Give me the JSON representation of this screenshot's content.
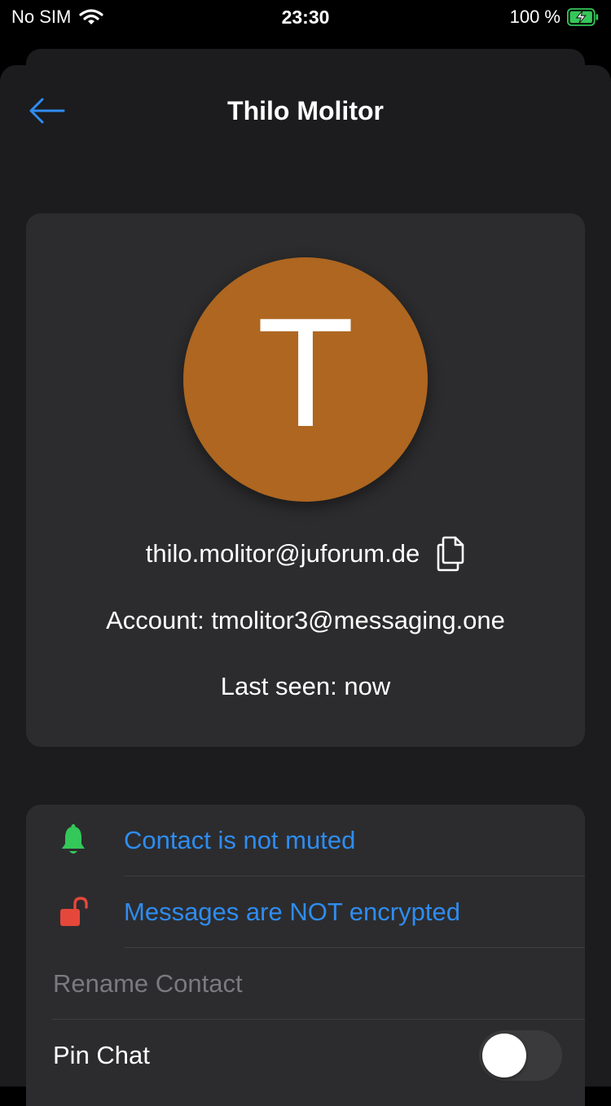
{
  "status_bar": {
    "carrier": "No SIM",
    "time": "23:30",
    "battery_percent": "100 %",
    "battery_level": 1.0
  },
  "nav": {
    "title": "Thilo Molitor"
  },
  "profile": {
    "avatar_letter": "T",
    "avatar_color": "#ae6620",
    "email": "thilo.molitor@juforum.de",
    "account": "Account: tmolitor3@messaging.one",
    "last_seen": "Last seen: now"
  },
  "settings": {
    "mute_label": "Contact is not muted",
    "encryption_label": "Messages are NOT encrypted",
    "rename_label": "Rename Contact",
    "pin_label": "Pin Chat",
    "pin_enabled": false
  },
  "colors": {
    "accent": "#2f8cf0",
    "bell": "#34c759",
    "lock": "#e5473b",
    "avatar": "#ae6620"
  }
}
